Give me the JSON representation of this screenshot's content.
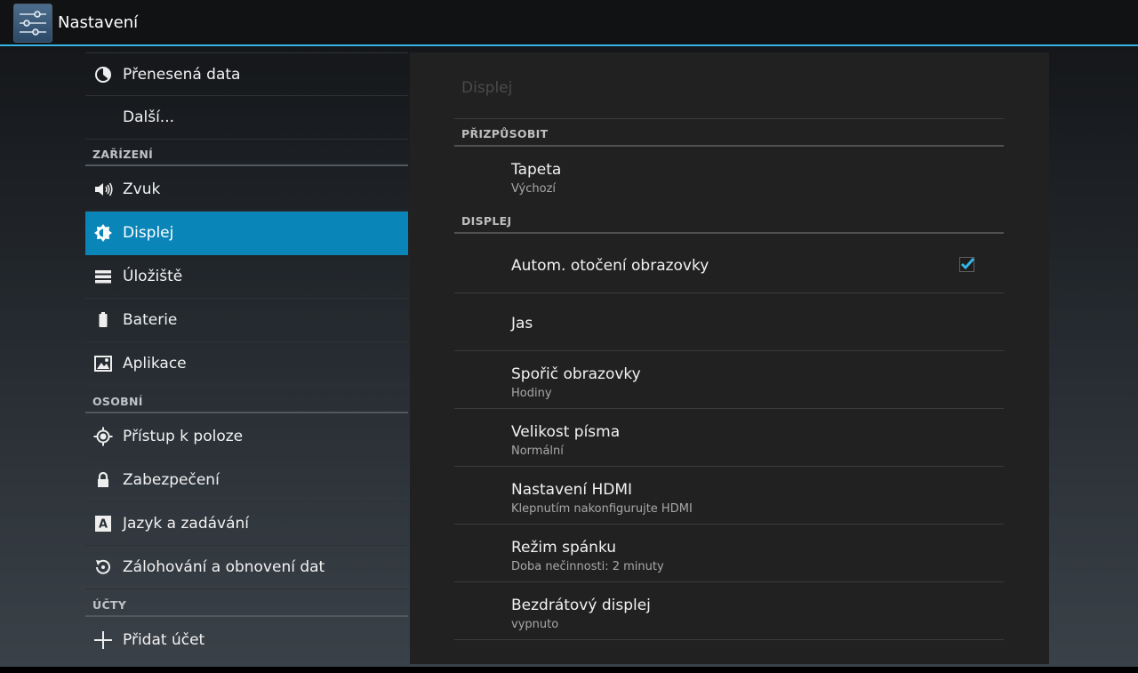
{
  "actionbar": {
    "title": "Nastavení",
    "icon": "settings-sliders-icon"
  },
  "sidebar": {
    "items": [
      {
        "label": "Přenesená data",
        "icon": "data-usage-icon"
      },
      {
        "label": "Další...",
        "icon": ""
      },
      {
        "label": "Zvuk",
        "icon": "speaker-icon"
      },
      {
        "label": "Displej",
        "icon": "brightness-icon",
        "selected": true
      },
      {
        "label": "Úložiště",
        "icon": "storage-icon"
      },
      {
        "label": "Baterie",
        "icon": "battery-icon"
      },
      {
        "label": "Aplikace",
        "icon": "apps-icon"
      },
      {
        "label": "Přístup k poloze",
        "icon": "location-icon"
      },
      {
        "label": "Zabezpečení",
        "icon": "lock-icon"
      },
      {
        "label": "Jazyk a zadávání",
        "icon": "keyboard-language-icon"
      },
      {
        "label": "Zálohování a obnovení dat",
        "icon": "backup-restore-icon"
      },
      {
        "label": "Přidat účet",
        "icon": "add-icon"
      }
    ],
    "headers": [
      "ZAŘÍZENÍ",
      "OSOBNÍ",
      "ÚČTY"
    ]
  },
  "panel": {
    "title": "Displej",
    "sections": [
      {
        "label": "PŘIZPŮSOBIT"
      },
      {
        "label": "DISPLEJ"
      }
    ],
    "rows": [
      {
        "title": "Tapeta",
        "summary": "Výchozí"
      },
      {
        "title": "Autom. otočení obrazovky",
        "summary": "",
        "checked": true
      },
      {
        "title": "Jas",
        "summary": ""
      },
      {
        "title": "Spořič obrazovky",
        "summary": "Hodiny"
      },
      {
        "title": "Velikost písma",
        "summary": "Normální"
      },
      {
        "title": "Nastavení HDMI",
        "summary": "Klepnutím nakonfigurujte HDMI"
      },
      {
        "title": "Režim spánku",
        "summary": "Doba nečinnosti: 2 minuty"
      },
      {
        "title": "Bezdrátový displej",
        "summary": "vypnuto"
      }
    ]
  },
  "colors": {
    "accent": "#33b5e5",
    "selected": "#0985b8",
    "panel": "#212121"
  }
}
